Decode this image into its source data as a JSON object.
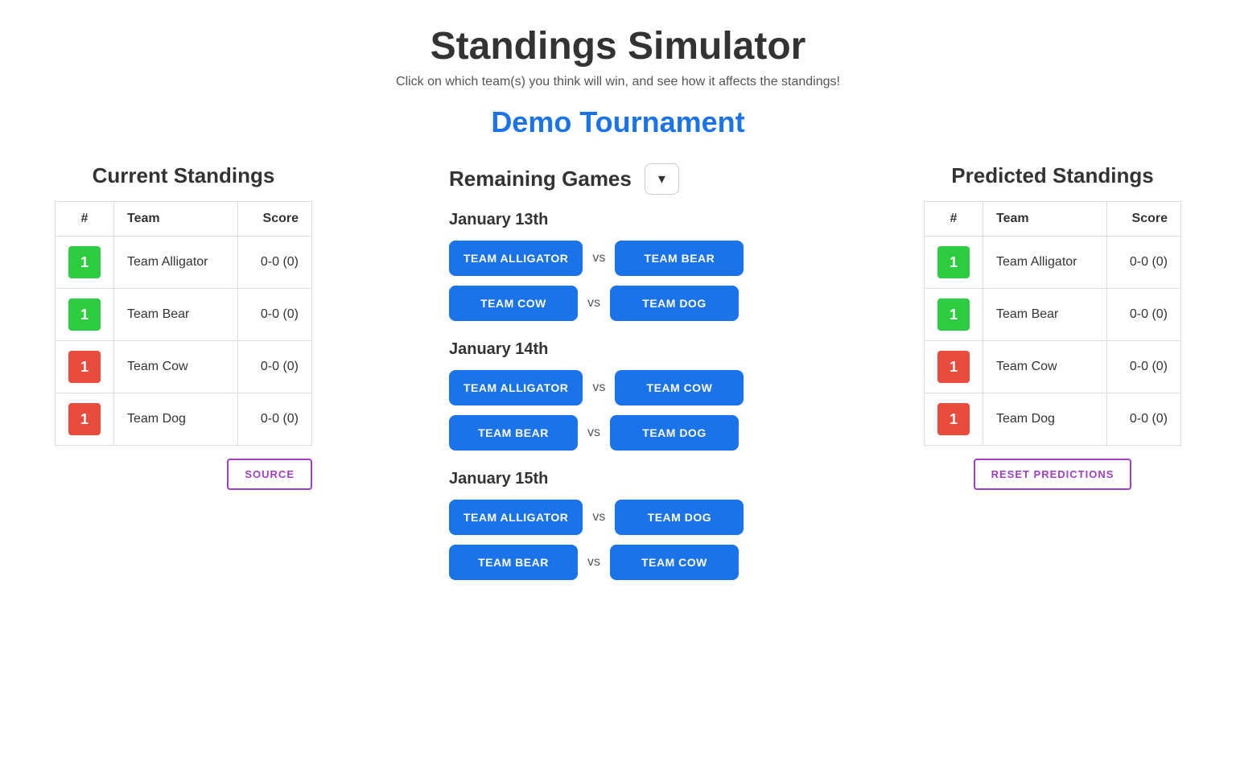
{
  "header": {
    "title": "Standings Simulator",
    "subtitle": "Click on which team(s) you think will win, and see how it affects the standings!",
    "tournament": "Demo Tournament"
  },
  "left_panel": {
    "title": "Current Standings",
    "table": {
      "columns": [
        "#",
        "Team",
        "Score"
      ],
      "rows": [
        {
          "rank": "1",
          "rank_color": "green",
          "team": "Team Alligator",
          "score": "0-0 (0)"
        },
        {
          "rank": "1",
          "rank_color": "green",
          "team": "Team Bear",
          "score": "0-0 (0)"
        },
        {
          "rank": "1",
          "rank_color": "red",
          "team": "Team Cow",
          "score": "0-0 (0)"
        },
        {
          "rank": "1",
          "rank_color": "red",
          "team": "Team Dog",
          "score": "0-0 (0)"
        }
      ]
    },
    "source_button": "SOURCE"
  },
  "center_panel": {
    "title": "Remaining Games",
    "dropdown_icon": "▾",
    "days": [
      {
        "date": "January 13th",
        "games": [
          {
            "team1": "TEAM ALLIGATOR",
            "team2": "TEAM BEAR"
          },
          {
            "team1": "TEAM COW",
            "team2": "TEAM DOG"
          }
        ]
      },
      {
        "date": "January 14th",
        "games": [
          {
            "team1": "TEAM ALLIGATOR",
            "team2": "TEAM COW"
          },
          {
            "team1": "TEAM BEAR",
            "team2": "TEAM DOG"
          }
        ]
      },
      {
        "date": "January 15th",
        "games": [
          {
            "team1": "TEAM ALLIGATOR",
            "team2": "TEAM DOG"
          },
          {
            "team1": "TEAM BEAR",
            "team2": "TEAM COW"
          }
        ]
      }
    ],
    "vs_label": "vs"
  },
  "right_panel": {
    "title": "Predicted Standings",
    "table": {
      "columns": [
        "#",
        "Team",
        "Score"
      ],
      "rows": [
        {
          "rank": "1",
          "rank_color": "green",
          "team": "Team Alligator",
          "score": "0-0 (0)"
        },
        {
          "rank": "1",
          "rank_color": "green",
          "team": "Team Bear",
          "score": "0-0 (0)"
        },
        {
          "rank": "1",
          "rank_color": "red",
          "team": "Team Cow",
          "score": "0-0 (0)"
        },
        {
          "rank": "1",
          "rank_color": "red",
          "team": "Team Dog",
          "score": "0-0 (0)"
        }
      ]
    },
    "reset_button": "RESET PREDICTIONS"
  }
}
